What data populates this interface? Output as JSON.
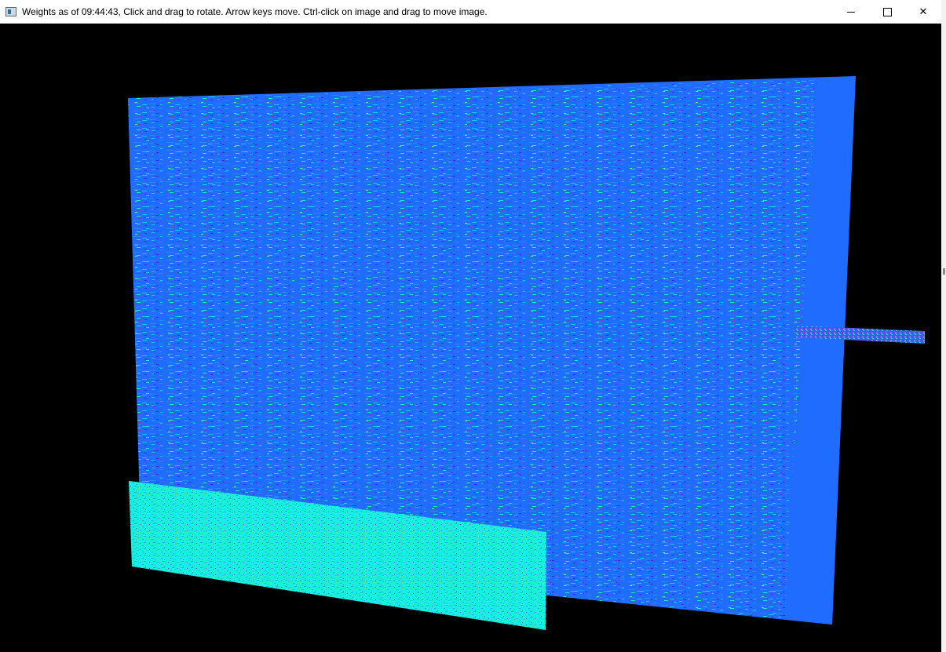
{
  "window": {
    "title": "Weights as of 09:44:43, Click and drag to rotate. Arrow keys move.  Ctrl-click on image and drag to move image.",
    "app_icon": "opengl-window-icon",
    "controls": {
      "minimize": "minimize-icon",
      "maximize": "maximize-icon",
      "close": "close-icon"
    }
  },
  "viewport": {
    "background": "#000000"
  },
  "planes": {
    "large": {
      "color": "#1f6cff",
      "label": "large-weight-plane"
    },
    "bottom": {
      "color": "#17f0de",
      "label": "bottom-weight-plane"
    },
    "right_strip": {
      "color": "#3a5cff",
      "label": "right-weight-strip"
    }
  },
  "colormap": [
    "#1f6cff",
    "#2a8cff",
    "#1ec8ff",
    "#22f0d8",
    "#6cff8a",
    "#2230ff",
    "#5a16d8",
    "#9e2ad6"
  ]
}
